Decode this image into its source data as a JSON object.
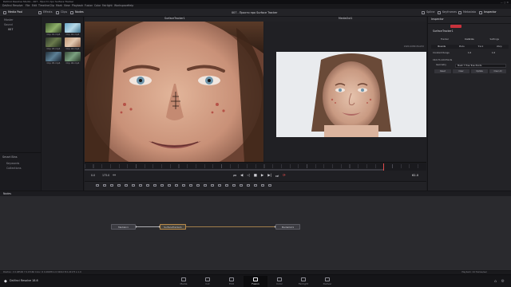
{
  "window": {
    "title": "DaVinci Resolve Studio - 007 - Просто про Surface Tracker"
  },
  "menu": [
    "DaVinci Resolve",
    "File",
    "Edit",
    "Timeline",
    "Clip",
    "Mark",
    "View",
    "Playback",
    "Fusion",
    "Color",
    "Fairlight",
    "Workspace",
    "Help"
  ],
  "toolbar": {
    "left": [
      {
        "label": "Media Pool"
      },
      {
        "label": "Effects"
      },
      {
        "label": "Clips"
      },
      {
        "label": "Nodes"
      }
    ],
    "center_title": "007 - Просто про Surface Tracker",
    "right": [
      {
        "label": "Spline"
      },
      {
        "label": "Keyframes"
      },
      {
        "label": "Metadata"
      },
      {
        "label": "Inspector"
      }
    ]
  },
  "bins": [
    "Master",
    "Sound",
    "007"
  ],
  "smart_bins": {
    "title": "Smart Bins",
    "items": [
      "Keywords",
      "Collections"
    ]
  },
  "clips": [
    {
      "name": "Clip 01.mp4"
    },
    {
      "name": "Clip 02.mp4"
    },
    {
      "name": "Clip 03.mp4"
    },
    {
      "name": "Clip 04.mp4"
    },
    {
      "name": "Clip 05.mp4"
    },
    {
      "name": "Clip 06.mp4"
    }
  ],
  "viewer": {
    "left_label": "SurfaceTracker1",
    "right_label": "MediaOut1",
    "right_info": "1920x1080xfloat32",
    "timecode_start": "0.0",
    "timecode_mid": "173.0",
    "frame_current": "62.0"
  },
  "inspector": {
    "title": "Inspector",
    "node_name": "SurfaceTracker1",
    "tabs": [
      "Tracker",
      "Controls",
      "Settings"
    ],
    "sub_tabs": [
      "Bounds",
      "Mode",
      "Track",
      "Warp"
    ],
    "fields": [
      {
        "label": "Constant Range",
        "a": "1.0",
        "b": "1.0"
      },
      {
        "label": "Click To Add Points",
        "a": "",
        "b": ""
      }
    ],
    "geometry_label": "Geometry",
    "geometry_value": "Mesh 7 Tree Tree Points",
    "buttons": [
      "Reset",
      "Clear",
      "Update",
      "Clear All"
    ]
  },
  "nodes": {
    "header": "Nodes",
    "items": [
      {
        "label": "MediaIn1"
      },
      {
        "label": "SurfaceTracker1"
      },
      {
        "label": "MediaOut1"
      }
    ]
  },
  "status": {
    "left": "Position: X 0.48500   Y 0.47166   Color: R 0.46938   G 0.34012   B 0.22175   A 1.0",
    "right": "Playback: 24 frames/sec"
  },
  "app_name": "DaVinci Resolve 18.6",
  "pages": [
    {
      "label": "Media"
    },
    {
      "label": "Cut"
    },
    {
      "label": "Edit"
    },
    {
      "label": "Fusion",
      "active": true
    },
    {
      "label": "Color"
    },
    {
      "label": "Fairlight"
    },
    {
      "label": "Deliver"
    }
  ],
  "colors": {
    "accent_red": "#c8323c",
    "node_select": "#b98a4a",
    "playhead": "#e24b4b"
  }
}
